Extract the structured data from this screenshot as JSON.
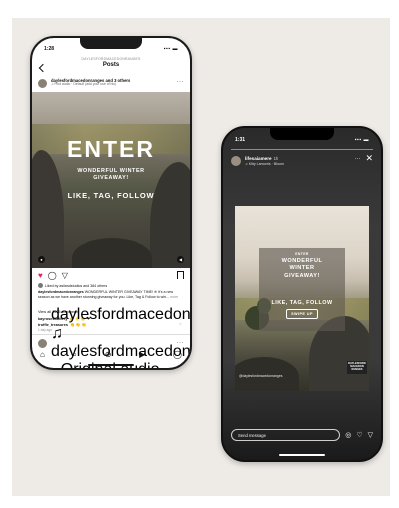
{
  "phone1": {
    "status": {
      "time": "1:28",
      "signal": "▪▪▪ ▬"
    },
    "header": {
      "username_small": "DAYLESFORDMACEDONRANGES",
      "title": "Posts"
    },
    "post": {
      "username": "daylesfordmacedonranges and 3 others",
      "audio": "♫ Find audio · Default (add your use of his)",
      "image_text": {
        "headline": "ENTER",
        "subtitle_line1": "WONDERFUL WINTER",
        "subtitle_line2": "GIVEAWAY!",
        "cta": "LIKE, TAG, FOLLOW"
      },
      "liked_by": "Liked by asilandstudios and 384 others",
      "caption_user": "daylesfordmacedonranges",
      "caption_text": "WONDERFUL WINTER GIVEAWAY TIME! ❄ It's a new season as we have another stunning giveaway for you. Like, Tag & Follow to win...",
      "caption_more": "more",
      "view_comments": "View all 1405 comments",
      "comments": [
        {
          "user": "kayrosesbottery",
          "text": "👍 🌟 👏 ❤"
        },
        {
          "user": "truffle_treasures",
          "text": "👏 👏 👏"
        }
      ],
      "time_ago": "1 day ago"
    },
    "next_post": {
      "username": "daylesfordmacedonranges",
      "audio": "♫ daylesfordmacedon.ranges · Original audio"
    },
    "tabs": [
      "⌂",
      "⌕",
      "⊕",
      "▶",
      "◯"
    ]
  },
  "phone2": {
    "status": {
      "time": "1:31",
      "signal": "▪▪▪ ▬"
    },
    "story": {
      "username": "lifesaiamere",
      "time": "1h",
      "subtitle": "♫ Kitty Lamorris · Bloom",
      "card": {
        "top_text": "ENTER",
        "subtitle_line1": "WONDERFUL",
        "subtitle_line2": "WINTER",
        "subtitle_line3": "GIVEAWAY!",
        "cta": "LIKE, TAG, FOLLOW",
        "button": "SWIPE UP"
      },
      "photo_credit": "@daylesfordmacedonranges",
      "sticker": "DAYLESFORD MACEDON RANGES",
      "send_placeholder": "Send message"
    }
  },
  "colors": {
    "heart": "#e0245e",
    "backdrop": "#eeeae6"
  }
}
